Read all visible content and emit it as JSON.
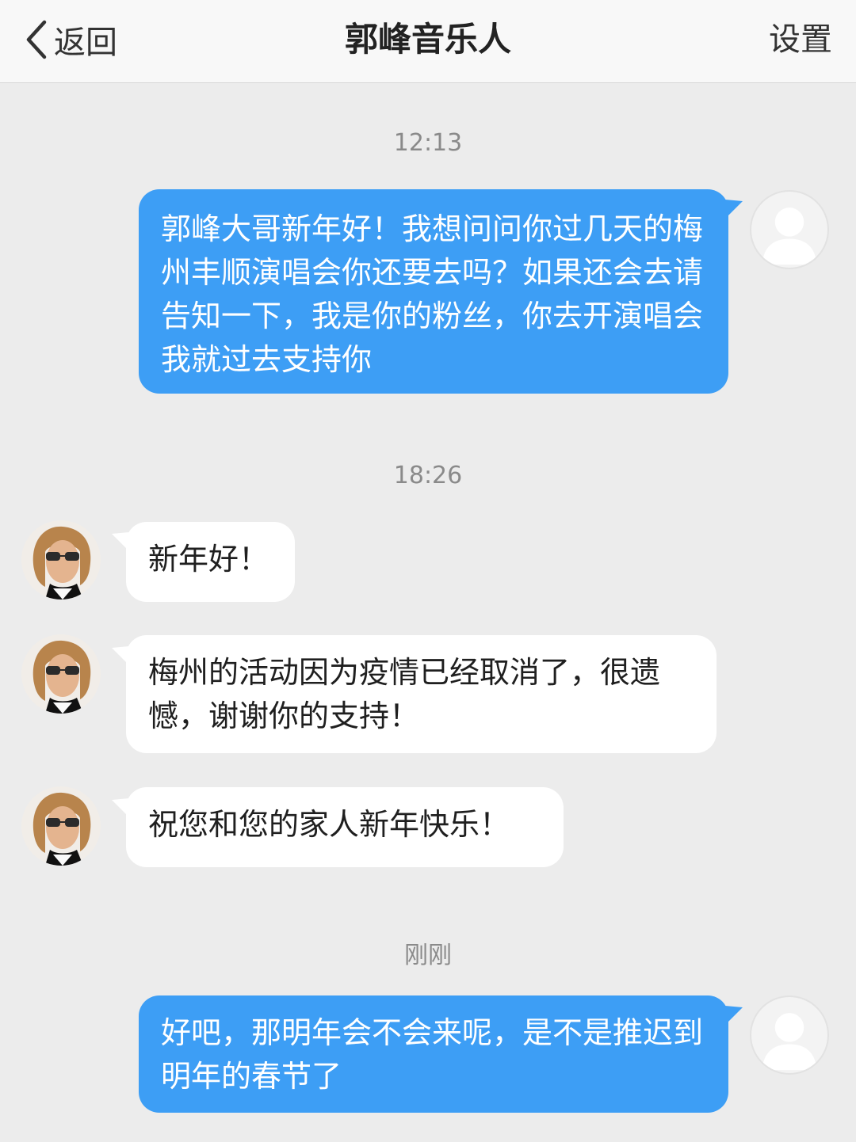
{
  "nav": {
    "back_label": "返回",
    "title": "郭峰音乐人",
    "settings_label": "设置"
  },
  "colors": {
    "outgoing_bubble": "#3d9ef5",
    "incoming_bubble": "#ffffff",
    "background": "#ececec"
  },
  "chat": {
    "timestamps": [
      "12:13",
      "18:26",
      "刚刚"
    ],
    "messages": [
      {
        "direction": "out",
        "avatar": "default-avatar-icon",
        "text": "郭峰大哥新年好！我想问问你过几天的梅州丰顺演唱会你还要去吗？如果还会去请告知一下，我是你的粉丝，你去开演唱会我就过去支持你"
      },
      {
        "direction": "in",
        "avatar": "contact-avatar",
        "text": "新年好！"
      },
      {
        "direction": "in",
        "avatar": "contact-avatar",
        "text": "梅州的活动因为疫情已经取消了，很遗憾，谢谢你的支持！"
      },
      {
        "direction": "in",
        "avatar": "contact-avatar",
        "text": "祝您和您的家人新年快乐！"
      },
      {
        "direction": "out",
        "avatar": "default-avatar-icon",
        "text": "好吧，那明年会不会来呢，是不是推迟到明年的春节了"
      }
    ]
  }
}
